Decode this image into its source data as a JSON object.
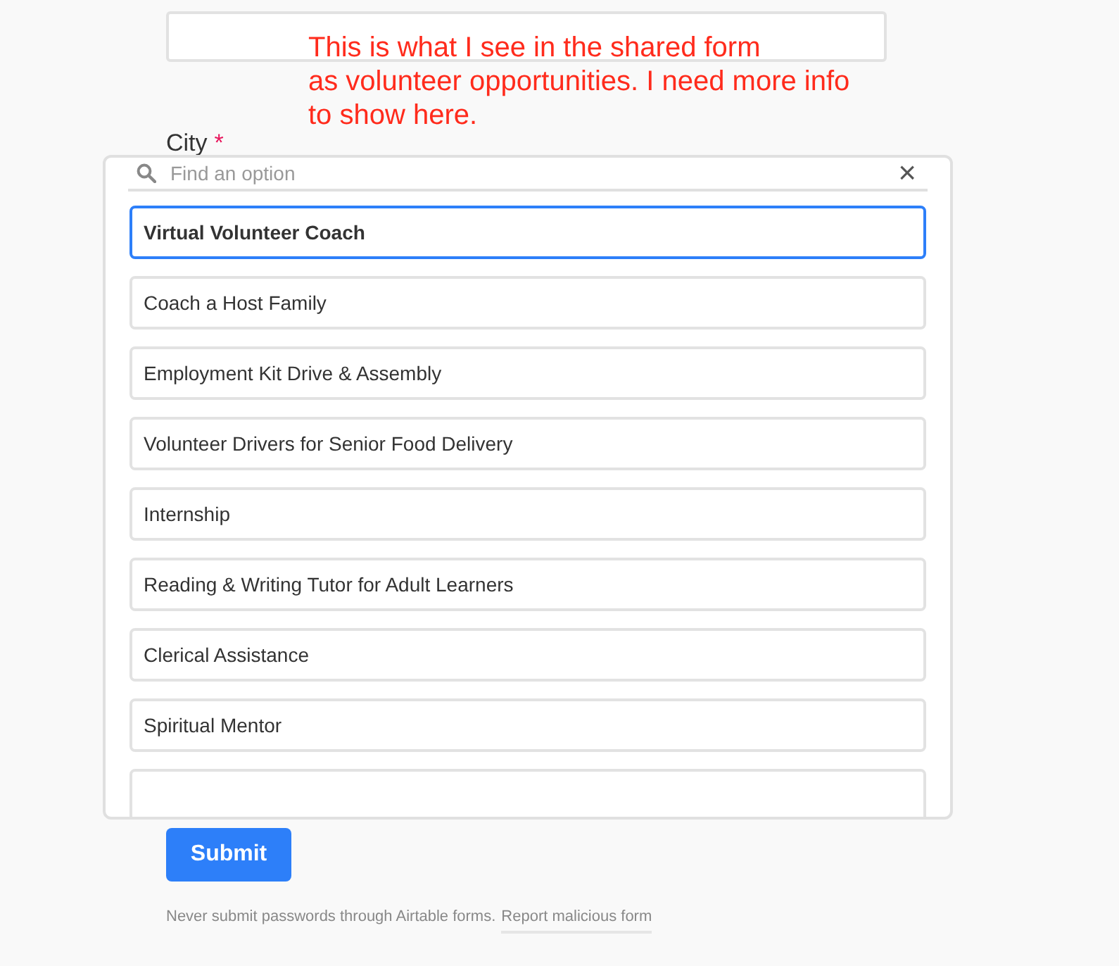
{
  "annotation": "This is what I see in the shared form\nas volunteer opportunities. I need more info\nto show here.",
  "field": {
    "label": "City",
    "required_mark": "*"
  },
  "dropdown": {
    "search": {
      "placeholder": "Find an option"
    },
    "close": "×",
    "options": [
      {
        "label": "Virtual Volunteer Coach",
        "selected": true
      },
      {
        "label": "Coach a Host Family",
        "selected": false
      },
      {
        "label": "Employment Kit Drive & Assembly",
        "selected": false
      },
      {
        "label": "Volunteer Drivers for Senior Food Delivery",
        "selected": false
      },
      {
        "label": "Internship",
        "selected": false
      },
      {
        "label": "Reading & Writing Tutor for Adult Learners",
        "selected": false
      },
      {
        "label": "Clerical Assistance",
        "selected": false
      },
      {
        "label": "Spiritual Mentor",
        "selected": false
      }
    ]
  },
  "submit": "Submit",
  "footer": {
    "note": "Never submit passwords through Airtable forms.",
    "link": "Report malicious form"
  }
}
